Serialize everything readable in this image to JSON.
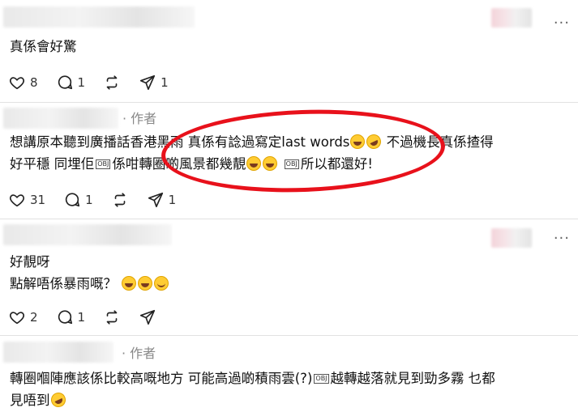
{
  "comments": [
    {
      "author_label": "",
      "text_lines": [
        "真係會好驚"
      ],
      "likes": "8",
      "replies": "1",
      "reposts": "",
      "shares": "1"
    },
    {
      "author_label": "· 作者",
      "text_lines": [
        "想講原本聽到廣播話香港黑雨 真係有諗過寫定last words",
        "不過機長真係揸得",
        "好平穩 同埋佢",
        "係咁轉圈啲風景都幾靚",
        "所以都還好!"
      ],
      "likes": "31",
      "replies": "1",
      "reposts": "",
      "shares": "1"
    },
    {
      "author_label": "",
      "text_lines": [
        "好靚呀",
        "點解唔係暴雨嘅？"
      ],
      "likes": "2",
      "replies": "1",
      "reposts": "",
      "shares": ""
    },
    {
      "author_label": "· 作者",
      "text_lines": [
        "轉圈嗰陣應該係比較高嘅地方 可能高過啲積雨雲(?)",
        "越轉越落就見到勁多霧 乜都",
        "見唔到"
      ]
    }
  ],
  "more_icon": "more-horizontal-icon",
  "icons": [
    "heart-icon",
    "comment-icon",
    "repost-icon",
    "share-icon"
  ],
  "colors": {
    "annotation": "#e8111b",
    "muted": "#888888"
  }
}
